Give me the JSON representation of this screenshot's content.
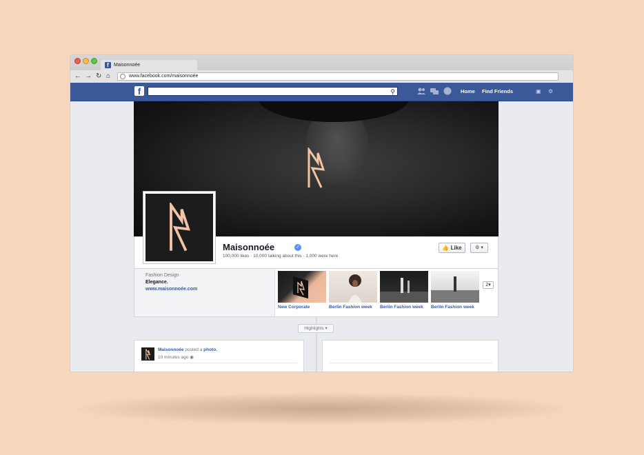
{
  "browser": {
    "tab_title": "Maisonnoée",
    "address": "www.facebook.com/maisonnoée",
    "favicon": "f",
    "nav_icons": [
      "back-arrow-icon",
      "forward-arrow-icon",
      "reload-icon",
      "home-icon"
    ]
  },
  "facebook_header": {
    "logo": "f",
    "search_placeholder": "",
    "links": [
      "Home",
      "Find Friends"
    ]
  },
  "page": {
    "name": "Maisonnoée",
    "stats": "100,000 likes · 10,000 talking about this · 1,000 were here",
    "like_label": "Like",
    "about": {
      "category": "Fashion Design",
      "description": "Elegance.",
      "website": "www.maisonnoée.com"
    },
    "photos": [
      {
        "caption": "New Corporate"
      },
      {
        "caption": "Berlin Fashion week"
      },
      {
        "caption": "Berlin Fashion week"
      },
      {
        "caption": "Berlin Fashion week"
      }
    ],
    "more_count": "2",
    "highlights_label": "Highlights",
    "post": {
      "author": "Maisonnoée",
      "action": "posted a",
      "object": "photo.",
      "time": "10 minutes ago"
    }
  },
  "colors": {
    "background": "#f6d6bd",
    "facebook_blue": "#3b5998",
    "brand_peach": "#f2c4a6"
  }
}
